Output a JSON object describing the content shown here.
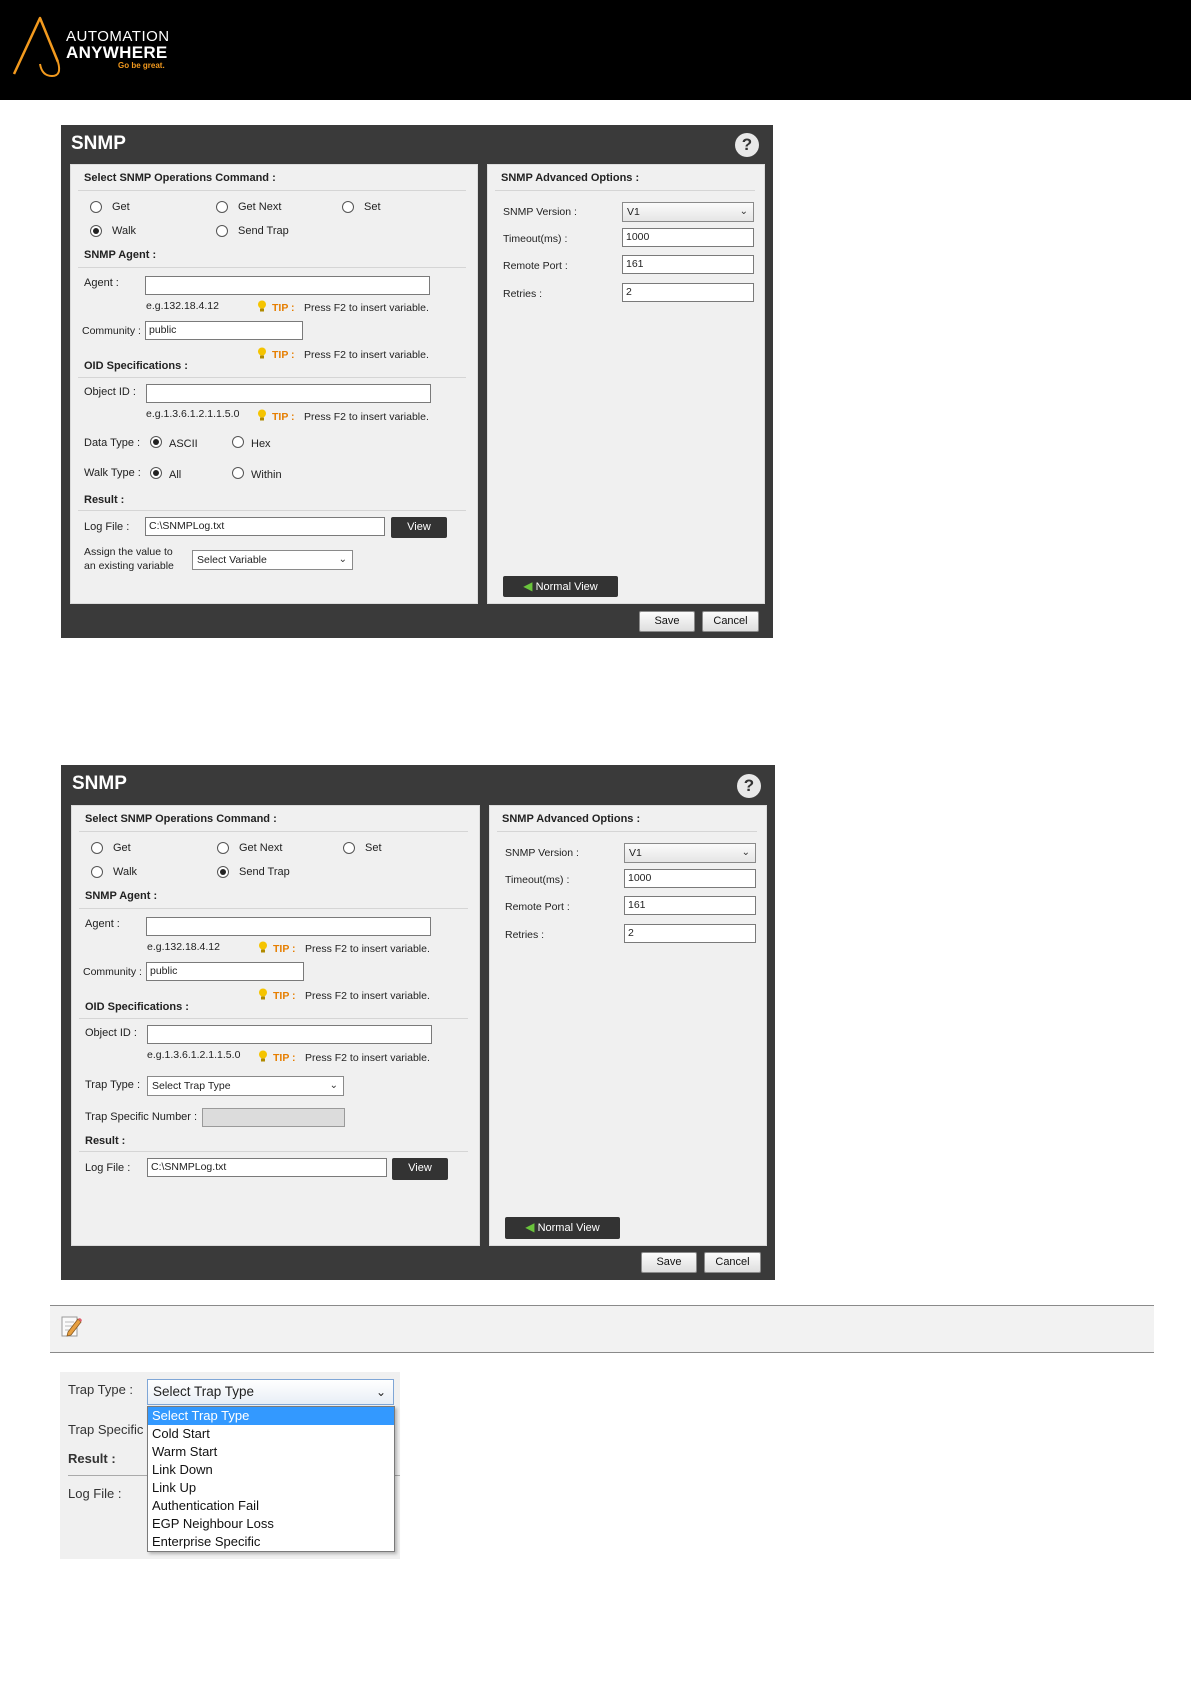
{
  "brand": {
    "line1": "AUTOMATION",
    "line2": "ANYWHERE",
    "tagline": "Go be great.",
    "colors": {
      "banner": "#000000",
      "accent": "#f39a1e"
    }
  },
  "dialog1": {
    "title": "SNMP",
    "help": "?",
    "ops_title": "Select SNMP Operations Command :",
    "ops": {
      "get": "Get",
      "get_next": "Get Next",
      "set": "Set",
      "walk": "Walk",
      "send_trap": "Send Trap"
    },
    "selected_op": "Walk",
    "agent_title": "SNMP Agent :",
    "agent_label": "Agent :",
    "agent_value": "",
    "agent_example": "e.g.132.18.4.12",
    "tip_word": "TIP :",
    "tip_text": "Press F2 to insert variable.",
    "community_label": "Community :",
    "community_value": "public",
    "oid_title": "OID Specifications :",
    "object_id_label": "Object ID :",
    "object_id_value": "",
    "oid_example": "e.g.1.3.6.1.2.1.1.5.0",
    "data_type_label": "Data Type :",
    "ascii": "ASCII",
    "hex": "Hex",
    "walk_type_label": "Walk Type :",
    "all": "All",
    "within": "Within",
    "result_title": "Result :",
    "log_file_label": "Log File :",
    "log_file_value": "C:\\SNMPLog.txt",
    "view": "View",
    "assign_line1": "Assign the value to",
    "assign_line2": "an existing variable",
    "select_variable": "Select Variable",
    "adv_title": "SNMP Advanced Options :",
    "snmp_version_label": "SNMP Version :",
    "snmp_version_value": "V1",
    "timeout_label": "Timeout(ms) :",
    "timeout_value": "1000",
    "remote_port_label": "Remote Port :",
    "remote_port_value": "161",
    "retries_label": "Retries :",
    "retries_value": "2",
    "normal_view": "Normal View",
    "save": "Save",
    "cancel": "Cancel"
  },
  "dialog2": {
    "title": "SNMP",
    "help": "?",
    "ops_title": "Select SNMP Operations Command :",
    "ops": {
      "get": "Get",
      "get_next": "Get Next",
      "set": "Set",
      "walk": "Walk",
      "send_trap": "Send Trap"
    },
    "selected_op": "Send Trap",
    "agent_title": "SNMP Agent :",
    "agent_label": "Agent :",
    "agent_value": "",
    "agent_example": "e.g.132.18.4.12",
    "tip_word": "TIP :",
    "tip_text": "Press F2 to insert variable.",
    "community_label": "Community :",
    "community_value": "public",
    "oid_title": "OID Specifications :",
    "object_id_label": "Object ID :",
    "object_id_value": "",
    "oid_example": "e.g.1.3.6.1.2.1.1.5.0",
    "trap_type_label": "Trap Type :",
    "trap_type_value": "Select Trap Type",
    "trap_specific_label": "Trap Specific Number :",
    "trap_specific_value": "",
    "result_title": "Result :",
    "log_file_label": "Log File :",
    "log_file_value": "C:\\SNMPLog.txt",
    "view": "View",
    "adv_title": "SNMP Advanced Options :",
    "snmp_version_label": "SNMP Version :",
    "snmp_version_value": "V1",
    "timeout_label": "Timeout(ms) :",
    "timeout_value": "1000",
    "remote_port_label": "Remote Port :",
    "remote_port_value": "161",
    "retries_label": "Retries :",
    "retries_value": "2",
    "normal_view": "Normal View",
    "save": "Save",
    "cancel": "Cancel"
  },
  "dropdown_zoom": {
    "trap_type_label": "Trap Type :",
    "selected_value": "Select Trap Type",
    "trap_specific_partial": "Trap Specific",
    "result_title": "Result :",
    "log_file_label": "Log File :",
    "options": [
      "Select Trap Type",
      "Cold Start",
      "Warm Start",
      "Link Down",
      "Link Up",
      "Authentication Fail",
      "EGP Neighbour Loss",
      "Enterprise Specific"
    ],
    "highlighted_index": 0,
    "highlight_color": "#3399ff"
  }
}
